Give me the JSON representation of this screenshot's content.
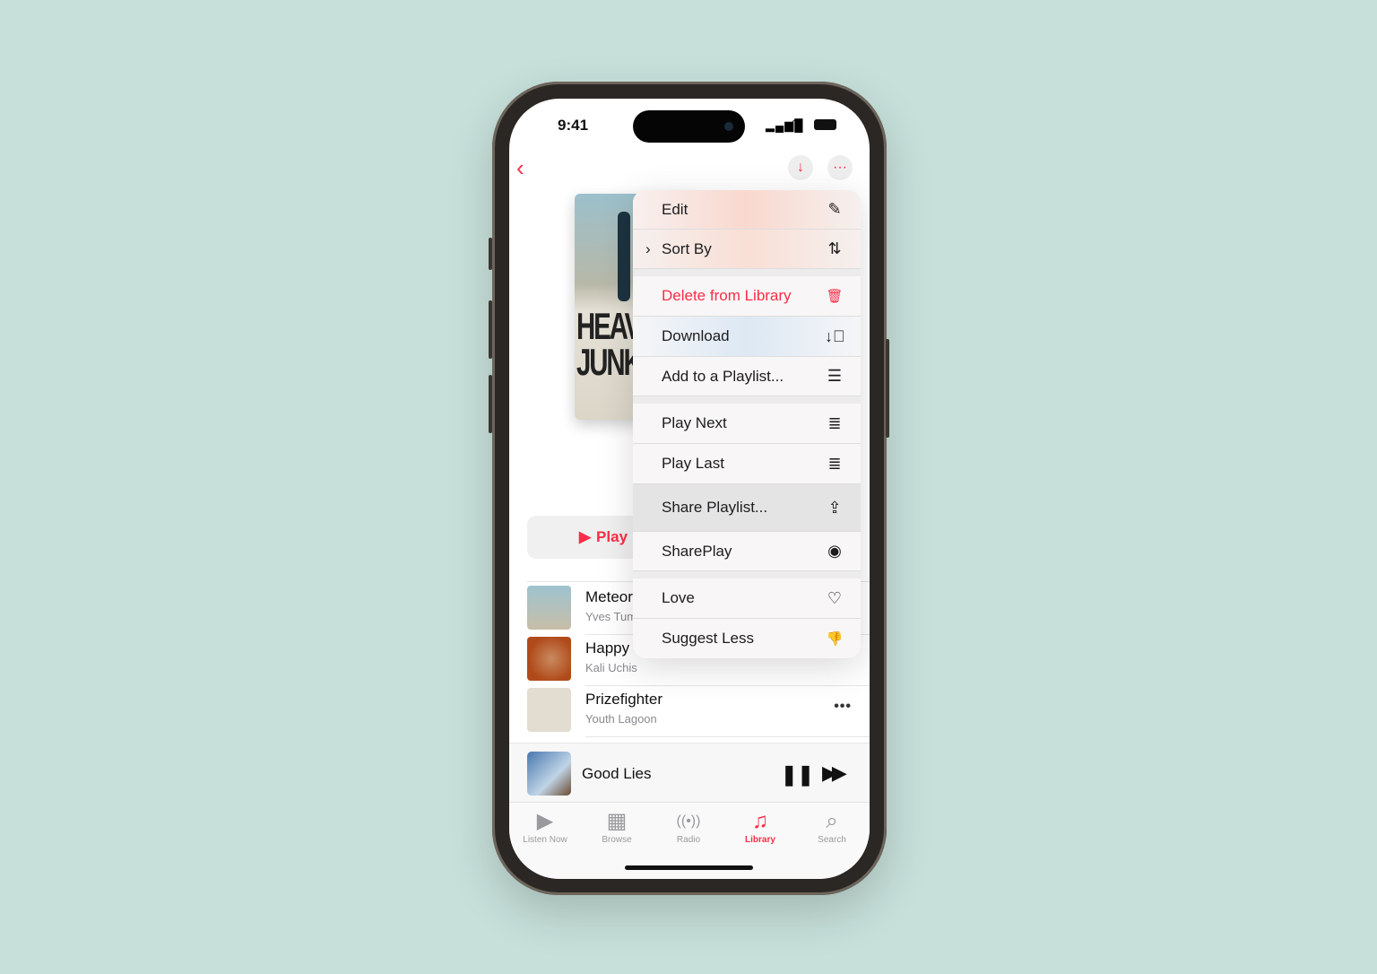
{
  "status": {
    "time": "9:41"
  },
  "nav": {
    "back_icon": "chevron-left-icon",
    "download_icon": "arrow-down-icon",
    "more_icon": "ellipsis-icon"
  },
  "album": {
    "cover_text": "HEAV IS JUNK"
  },
  "play_button": {
    "label": "Play"
  },
  "menu": {
    "items": [
      {
        "label": "Edit",
        "icon": "pencil-icon",
        "glyph": "✎"
      },
      {
        "label": "Sort By",
        "icon": "arrow-up-down-icon",
        "glyph": "⇅",
        "submenu": true
      },
      {
        "label": "Delete from Library",
        "icon": "trash-icon",
        "glyph": "🗑",
        "color": "#fa2d48"
      },
      {
        "label": "Download",
        "icon": "download-circle-icon",
        "glyph": "⊕"
      },
      {
        "label": "Add to a Playlist...",
        "icon": "add-playlist-icon",
        "glyph": "☰"
      },
      {
        "label": "Play Next",
        "icon": "play-next-icon",
        "glyph": "≣"
      },
      {
        "label": "Play Last",
        "icon": "play-last-icon",
        "glyph": "≣"
      },
      {
        "label": "Share Playlist...",
        "icon": "share-icon",
        "glyph": "⇪"
      },
      {
        "label": "SharePlay",
        "icon": "shareplay-icon",
        "glyph": "◉"
      },
      {
        "label": "Love",
        "icon": "heart-icon",
        "glyph": "♡"
      },
      {
        "label": "Suggest Less",
        "icon": "thumbs-down-icon",
        "glyph": "👎"
      }
    ]
  },
  "songs": [
    {
      "title": "Meteor",
      "artist": "Yves Tumor"
    },
    {
      "title": "Happy",
      "artist": "Kali Uchis"
    },
    {
      "title": "Prizefighter",
      "artist": "Youth Lagoon"
    }
  ],
  "now_playing": {
    "title": "Good Lies"
  },
  "tabs": [
    {
      "label": "Listen Now",
      "icon": "play-circle-icon"
    },
    {
      "label": "Browse",
      "icon": "grid-icon"
    },
    {
      "label": "Radio",
      "icon": "radio-icon"
    },
    {
      "label": "Library",
      "icon": "library-icon",
      "active": true
    },
    {
      "label": "Search",
      "icon": "search-icon"
    }
  ],
  "colors": {
    "accent": "#fa2d48",
    "background": "#c7e0da"
  }
}
